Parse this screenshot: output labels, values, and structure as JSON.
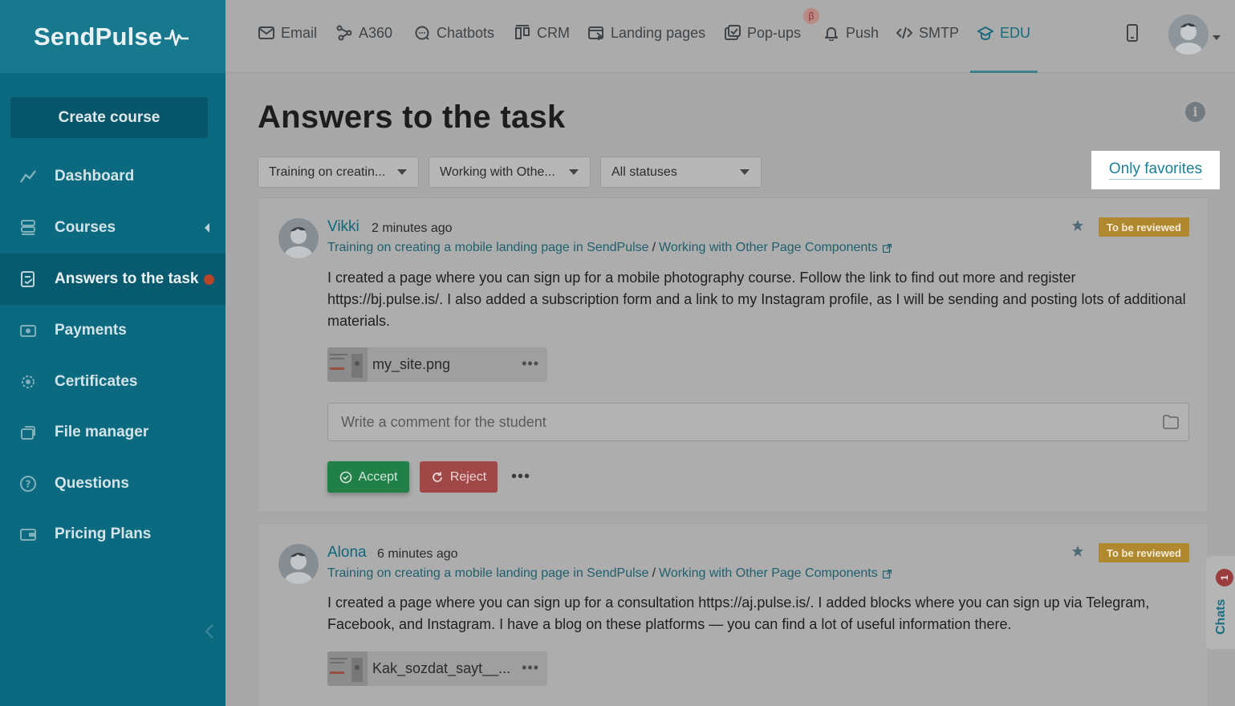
{
  "brand": {
    "name": "SendPulse"
  },
  "sidebar": {
    "create_label": "Create course",
    "items": [
      {
        "label": "Dashboard",
        "icon": "chart-line-icon"
      },
      {
        "label": "Courses",
        "icon": "courses-icon"
      },
      {
        "label": "Answers to the task",
        "icon": "answers-icon"
      },
      {
        "label": "Payments",
        "icon": "payments-icon"
      },
      {
        "label": "Certificates",
        "icon": "certificate-icon"
      },
      {
        "label": "File manager",
        "icon": "file-manager-icon"
      },
      {
        "label": "Questions",
        "icon": "question-icon"
      },
      {
        "label": "Pricing Plans",
        "icon": "wallet-icon"
      }
    ]
  },
  "topbar": {
    "items": [
      {
        "label": "Email",
        "icon": "email-icon"
      },
      {
        "label": "A360",
        "icon": "a360-icon"
      },
      {
        "label": "Chatbots",
        "icon": "chatbot-icon"
      },
      {
        "label": "CRM",
        "icon": "crm-icon"
      },
      {
        "label": "Landing pages",
        "icon": "landing-icon"
      },
      {
        "label": "Pop-ups",
        "icon": "popup-icon"
      },
      {
        "label": "Push",
        "icon": "bell-icon"
      },
      {
        "label": "SMTP",
        "icon": "code-icon"
      },
      {
        "label": "EDU",
        "icon": "graduation-cap-icon"
      }
    ],
    "beta_label": "β"
  },
  "main": {
    "title": "Answers to the task",
    "filters": {
      "course": "Training on creatin...",
      "lesson": "Working with Othe...",
      "status": "All statuses"
    },
    "only_favorites": "Only favorites"
  },
  "answers": [
    {
      "author": "Vikki",
      "time": "2 minutes ago",
      "course": "Training on creating a mobile landing page in SendPulse",
      "separator": "/",
      "lesson": "Working with Other Page Components",
      "status": "To be reviewed",
      "text": "I created a page where you can sign up for a mobile photography course. Follow the link to find out more and register https://bj.pulse.is/. I also added a subscription form and a link to my Instagram profile, as I will be sending and posting lots of additional materials.",
      "file": "my_site.png",
      "comment_placeholder": "Write a comment for the student",
      "accept_label": "Accept",
      "reject_label": "Reject",
      "more": "•••"
    },
    {
      "author": "Alona",
      "time": "6 minutes ago",
      "course": "Training on creating a mobile landing page in SendPulse",
      "separator": "/",
      "lesson": "Working with Other Page Components",
      "status": "To be reviewed",
      "text": "I created a page where you can sign up for a consultation https://aj.pulse.is/. I added blocks where you can sign up via Telegram, Facebook, and Instagram. I have a blog on these platforms — you can find a lot of useful information there.",
      "file": "Kak_sozdat_sayt__..."
    }
  ],
  "chats": {
    "label": "Chats",
    "count": "1"
  },
  "colors": {
    "sidebar": "#0b6a80",
    "accent": "#1b7f95",
    "accept": "#217f48",
    "reject": "#a04848",
    "badge": "#b08830"
  }
}
